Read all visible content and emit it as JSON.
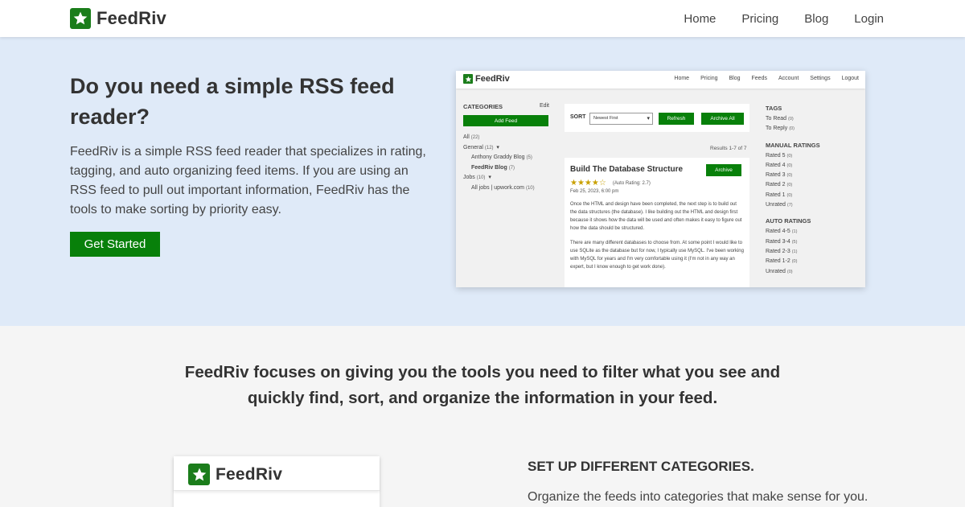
{
  "header": {
    "brand": "FeedRiv",
    "nav": [
      "Home",
      "Pricing",
      "Blog",
      "Login"
    ]
  },
  "hero": {
    "title": "Do you need a simple RSS feed reader?",
    "text": "FeedRiv is a simple RSS feed reader that specializes in rating, tagging, and auto organizing feed items. If you are using an RSS feed to pull out important information, FeedRiv has the tools to make sorting by priority easy.",
    "cta": "Get Started"
  },
  "preview": {
    "brand": "FeedRiv",
    "nav": [
      "Home",
      "Pricing",
      "Blog",
      "Feeds",
      "Account",
      "Settings",
      "Logout"
    ],
    "categories_label": "CATEGORIES",
    "edit": "Edit",
    "add_feed": "Add Feed",
    "list": {
      "all": "All",
      "all_cnt": "(22)",
      "general": "General",
      "general_cnt": "(12)",
      "anthony": "Anthony Graddy Blog",
      "anthony_cnt": "(5)",
      "feedriv_blog": "FeedRiv Blog",
      "feedriv_blog_cnt": "(7)",
      "jobs": "Jobs",
      "jobs_cnt": "(10)",
      "upwork": "All jobs | upwork.com",
      "upwork_cnt": "(10)"
    },
    "sort_label": "SORT",
    "sort_value": "Newest First",
    "refresh": "Refresh",
    "archive_all": "Archive All",
    "results": "Results 1-7 of 7",
    "card": {
      "title": "Build The Database Structure",
      "archive": "Archive",
      "stars": "★★★★☆",
      "auto_rating": "(Auto Rating: 2.7)",
      "date": "Feb 25, 2023, 6:00 pm",
      "para1": "Once the HTML and design have been completed, the next step is to build out the data structures (the database). I like building out the HTML and design first because it shows how the data will be used and often makes it easy to figure out how the data should be structured.",
      "para2": "There are many different databases to choose from. At some point I would like to use SQLite as the database but for now, I typically use MySQL. I've been working with MySQL for years and I'm very comfortable using it (I'm not in any way an expert, but I know enough to get work done)."
    },
    "tags_label": "TAGS",
    "tags": [
      {
        "label": "To Read",
        "cnt": "(0)"
      },
      {
        "label": "To Reply",
        "cnt": "(0)"
      }
    ],
    "manual_label": "MANUAL RATINGS",
    "manual": [
      {
        "label": "Rated 5",
        "cnt": "(0)"
      },
      {
        "label": "Rated 4",
        "cnt": "(0)"
      },
      {
        "label": "Rated 3",
        "cnt": "(0)"
      },
      {
        "label": "Rated 2",
        "cnt": "(0)"
      },
      {
        "label": "Rated 1",
        "cnt": "(0)"
      },
      {
        "label": "Unrated",
        "cnt": "(7)"
      }
    ],
    "auto_label": "AUTO RATINGS",
    "auto": [
      {
        "label": "Rated 4-5",
        "cnt": "(1)"
      },
      {
        "label": "Rated 3-4",
        "cnt": "(5)"
      },
      {
        "label": "Rated 2-3",
        "cnt": "(1)"
      },
      {
        "label": "Rated 1-2",
        "cnt": "(0)"
      },
      {
        "label": "Unrated",
        "cnt": "(0)"
      }
    ]
  },
  "tagline": "FeedRiv focuses on giving you the tools you need to filter what you see and quickly find, sort, and organize the information in your feed.",
  "feature": {
    "card_brand": "FeedRiv",
    "title": "SET UP DIFFERENT CATEGORIES.",
    "text": "Organize the feeds into categories that make sense for you."
  },
  "colors": {
    "brand_green": "#08800a",
    "hero_bg": "#dfeaf8",
    "page_bg": "#f5f5f5"
  },
  "icons": {
    "logo": "star-logo-icon",
    "dropdown": "chevron-down-icon"
  }
}
